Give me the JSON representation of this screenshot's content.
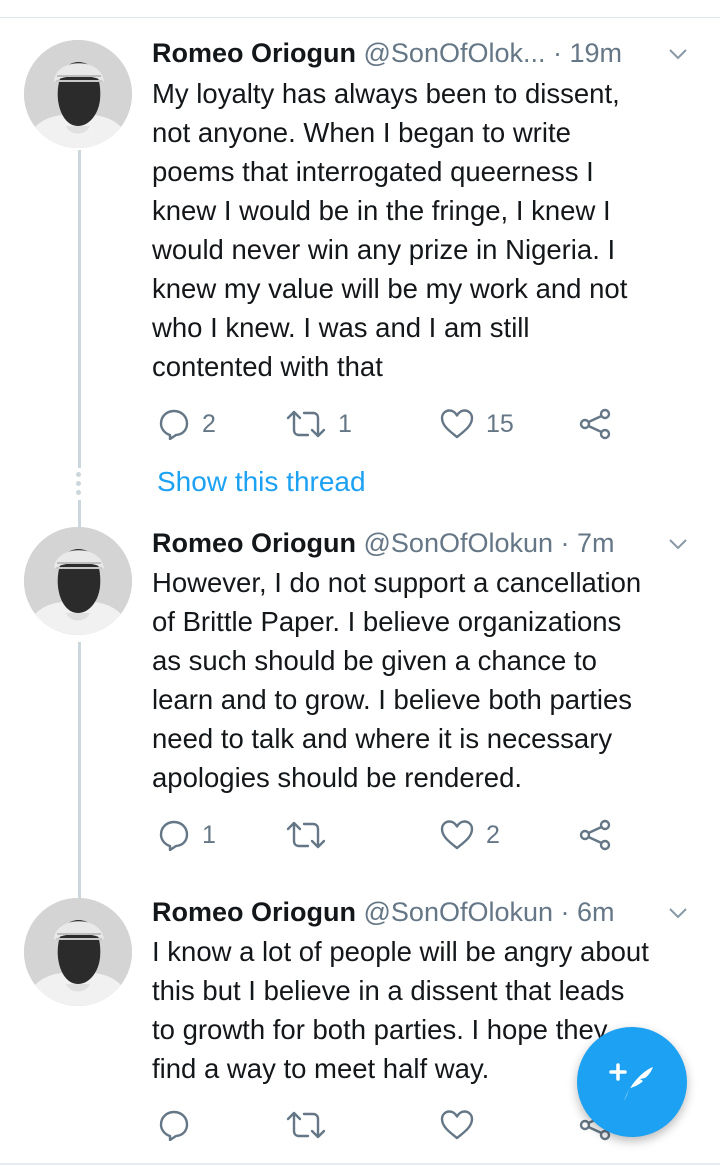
{
  "tweets": [
    {
      "name": "Romeo Oriogun",
      "handle": "@SonOfOlok...",
      "time": "· 19m",
      "lines": [
        "My loyalty has always been to dissent,",
        "not anyone. When I began to write",
        "poems that interrogated queerness I",
        "knew I would be in the fringe, I knew I",
        "would never win any prize in Nigeria. I",
        "knew my value will be my work and not",
        "who I knew. I was and I am still",
        "contented with that"
      ],
      "replies": "2",
      "retweets": "1",
      "likes": "15"
    },
    {
      "name": "Romeo Oriogun",
      "handle": "@SonOfOlokun",
      "time": "· 7m",
      "lines": [
        "However, I do not support a cancellation",
        "of Brittle Paper. I believe organizations",
        "as such should be given a chance to",
        "learn and to grow. I believe both parties",
        "need to talk and where it is necessary",
        "apologies should be rendered."
      ],
      "replies": "1",
      "retweets": "",
      "likes": "2"
    },
    {
      "name": "Romeo Oriogun",
      "handle": "@SonOfOlokun",
      "time": "· 6m",
      "lines": [
        "I know a lot of people will be angry about",
        "this but I believe in a dissent that leads",
        "to growth for both parties. I hope they",
        "find a way to meet half way."
      ],
      "replies": "",
      "retweets": "",
      "likes": ""
    }
  ],
  "show_thread": "Show this thread",
  "icons": {
    "reply": "reply-icon",
    "retweet": "retweet-icon",
    "like": "like-icon",
    "share": "share-icon",
    "caret": "chevron-down-icon",
    "compose": "compose-tweet-icon"
  },
  "colors": {
    "accent": "#1da1f2",
    "icon_gray": "#657786",
    "thread_line": "#ccd6dd"
  }
}
